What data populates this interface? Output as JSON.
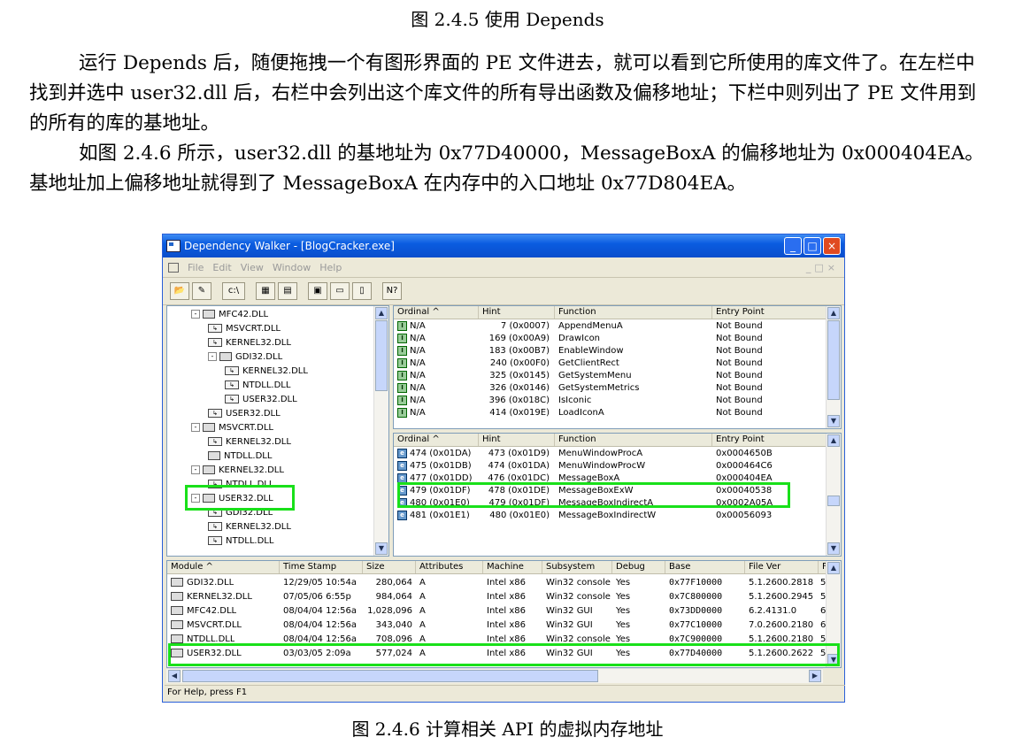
{
  "caption_top": "图 2.4.5    使用 Depends",
  "paragraphs": [
    "运行 Depends 后，随便拖拽一个有图形界面的 PE 文件进去，就可以看到它所使用的库文件了。在左栏中找到并选中 user32.dll 后，右栏中会列出这个库文件的所有导出函数及偏移地址；下栏中则列出了 PE 文件用到的所有的库的基地址。",
    "如图 2.4.6 所示，user32.dll 的基地址为 0x77D40000，MessageBoxA 的偏移地址为 0x000404EA。基地址加上偏移地址就得到了 MessageBoxA 在内存中的入口地址 0x77D804EA。"
  ],
  "caption_bottom": "图 2.4.6    计算相关 API 的虚拟内存地址",
  "window": {
    "title": "Dependency Walker - [BlogCracker.exe]",
    "menu": [
      "File",
      "Edit",
      "View",
      "Window",
      "Help"
    ],
    "toolbar_labels": {
      "path": "c:\\",
      "help": "N?"
    },
    "tree": [
      {
        "label": "MFC42.DLL",
        "depth": 1,
        "kind": "module",
        "expand": "-"
      },
      {
        "label": "MSVCRT.DLL",
        "depth": 2,
        "kind": "sub"
      },
      {
        "label": "KERNEL32.DLL",
        "depth": 2,
        "kind": "sub"
      },
      {
        "label": "GDI32.DLL",
        "depth": 2,
        "kind": "module",
        "expand": "-"
      },
      {
        "label": "KERNEL32.DLL",
        "depth": 3,
        "kind": "sub"
      },
      {
        "label": "NTDLL.DLL",
        "depth": 3,
        "kind": "sub"
      },
      {
        "label": "USER32.DLL",
        "depth": 3,
        "kind": "sub"
      },
      {
        "label": "USER32.DLL",
        "depth": 2,
        "kind": "sub"
      },
      {
        "label": "MSVCRT.DLL",
        "depth": 1,
        "kind": "module",
        "expand": "-"
      },
      {
        "label": "KERNEL32.DLL",
        "depth": 2,
        "kind": "sub"
      },
      {
        "label": "NTDLL.DLL",
        "depth": 2,
        "kind": "module"
      },
      {
        "label": "KERNEL32.DLL",
        "depth": 1,
        "kind": "module",
        "expand": "-"
      },
      {
        "label": "NTDLL.DLL",
        "depth": 2,
        "kind": "sub"
      },
      {
        "label": "USER32.DLL",
        "depth": 1,
        "kind": "module",
        "expand": "-"
      },
      {
        "label": "GDI32.DLL",
        "depth": 2,
        "kind": "sub"
      },
      {
        "label": "KERNEL32.DLL",
        "depth": 2,
        "kind": "sub"
      },
      {
        "label": "NTDLL.DLL",
        "depth": 2,
        "kind": "sub"
      }
    ],
    "imports": {
      "headers": [
        "Ordinal ^",
        "Hint",
        "Function",
        "Entry Point"
      ],
      "rows": [
        [
          "N/A",
          "7  (0x0007)",
          "AppendMenuA",
          "Not Bound"
        ],
        [
          "N/A",
          "169  (0x00A9)",
          "DrawIcon",
          "Not Bound"
        ],
        [
          "N/A",
          "183  (0x00B7)",
          "EnableWindow",
          "Not Bound"
        ],
        [
          "N/A",
          "240  (0x00F0)",
          "GetClientRect",
          "Not Bound"
        ],
        [
          "N/A",
          "325  (0x0145)",
          "GetSystemMenu",
          "Not Bound"
        ],
        [
          "N/A",
          "326  (0x0146)",
          "GetSystemMetrics",
          "Not Bound"
        ],
        [
          "N/A",
          "396  (0x018C)",
          "IsIconic",
          "Not Bound"
        ],
        [
          "N/A",
          "414  (0x019E)",
          "LoadIconA",
          "Not Bound"
        ]
      ]
    },
    "exports": {
      "headers": [
        "Ordinal ^",
        "Hint",
        "Function",
        "Entry Point"
      ],
      "rows": [
        [
          "474  (0x01DA)",
          "473  (0x01D9)",
          "MenuWindowProcA",
          "0x0004650B"
        ],
        [
          "475  (0x01DB)",
          "474  (0x01DA)",
          "MenuWindowProcW",
          "0x000464C6"
        ],
        [
          "477  (0x01DD)",
          "476  (0x01DC)",
          "MessageBoxA",
          "0x000404EA"
        ],
        [
          "479  (0x01DF)",
          "478  (0x01DE)",
          "MessageBoxExW",
          "0x00040538"
        ],
        [
          "480  (0x01E0)",
          "479  (0x01DF)",
          "MessageBoxIndirectA",
          "0x0002A05A"
        ],
        [
          "481  (0x01E1)",
          "480  (0x01E0)",
          "MessageBoxIndirectW",
          "0x00056093"
        ]
      ]
    },
    "modules": {
      "headers": [
        "Module ^",
        "Time Stamp",
        "Size",
        "Attributes",
        "Machine",
        "Subsystem",
        "Debug",
        "Base",
        "File Ver",
        "F"
      ],
      "rows": [
        [
          "GDI32.DLL",
          "12/29/05  10:54a",
          "280,064",
          "A",
          "Intel x86",
          "Win32 console",
          "Yes",
          "0x77F10000",
          "5.1.2600.2818",
          "5"
        ],
        [
          "KERNEL32.DLL",
          "07/05/06   6:55p",
          "984,064",
          "A",
          "Intel x86",
          "Win32 console",
          "Yes",
          "0x7C800000",
          "5.1.2600.2945",
          "5"
        ],
        [
          "MFC42.DLL",
          "08/04/04  12:56a",
          "1,028,096",
          "A",
          "Intel x86",
          "Win32 GUI",
          "Yes",
          "0x73DD0000",
          "6.2.4131.0",
          "6"
        ],
        [
          "MSVCRT.DLL",
          "08/04/04  12:56a",
          "343,040",
          "A",
          "Intel x86",
          "Win32 GUI",
          "Yes",
          "0x77C10000",
          "7.0.2600.2180",
          "6"
        ],
        [
          "NTDLL.DLL",
          "08/04/04  12:56a",
          "708,096",
          "A",
          "Intel x86",
          "Win32 console",
          "Yes",
          "0x7C900000",
          "5.1.2600.2180",
          "5"
        ],
        [
          "USER32.DLL",
          "03/03/05   2:09a",
          "577,024",
          "A",
          "Intel x86",
          "Win32 GUI",
          "Yes",
          "0x77D40000",
          "5.1.2600.2622",
          "5"
        ]
      ]
    },
    "status": "For Help, press F1"
  },
  "colors": {
    "highlight": "#19e01a",
    "titlebar": "#0a5ce0"
  }
}
